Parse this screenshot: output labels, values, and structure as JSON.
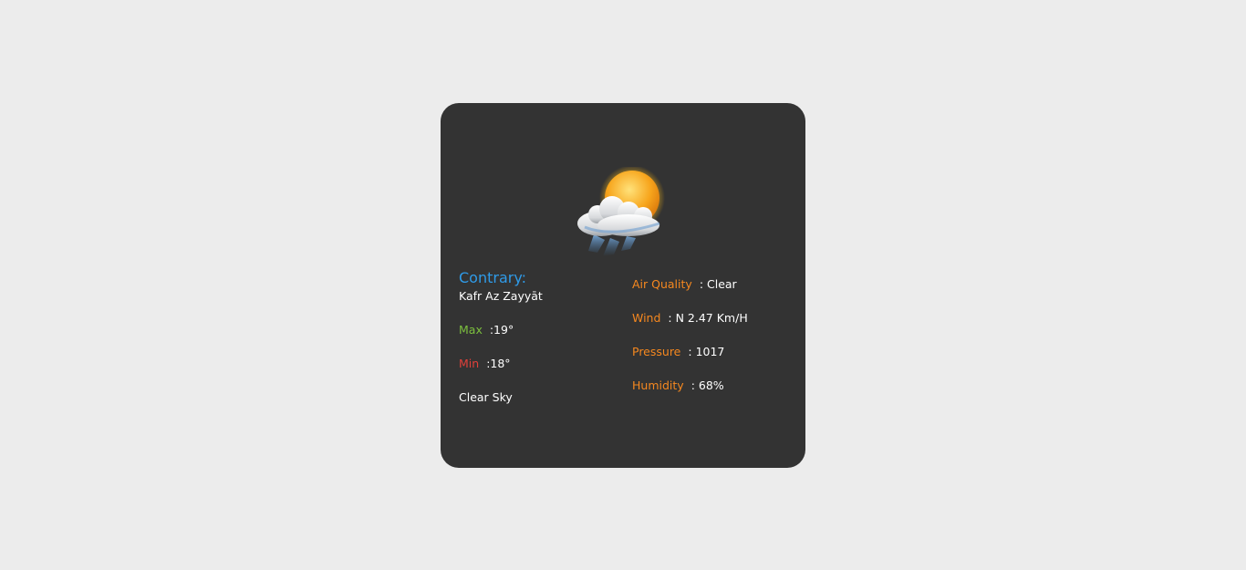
{
  "weather": {
    "icon": "sun-behind-rain-cloud-icon",
    "country_label": "Contrary:",
    "city": "Kafr Az Zayyāt",
    "max_label": "Max",
    "max_value": ":19°",
    "min_label": "Min",
    "min_value": ":18°",
    "description": "Clear Sky",
    "air_quality_label": "Air Quality",
    "air_quality_value": ": Clear",
    "wind_label": "Wind",
    "wind_value": ": N 2.47 Km/H",
    "pressure_label": "Pressure",
    "pressure_value": ": 1017",
    "humidity_label": "Humidity",
    "humidity_value": ": 68%"
  },
  "colors": {
    "page_background": "#ececec",
    "card_background": "#333333",
    "country_accent": "#2f9be8",
    "max_accent": "#7cbf3e",
    "min_accent": "#e0403a",
    "label_accent": "#f6881f",
    "value_text": "#ffffff"
  }
}
